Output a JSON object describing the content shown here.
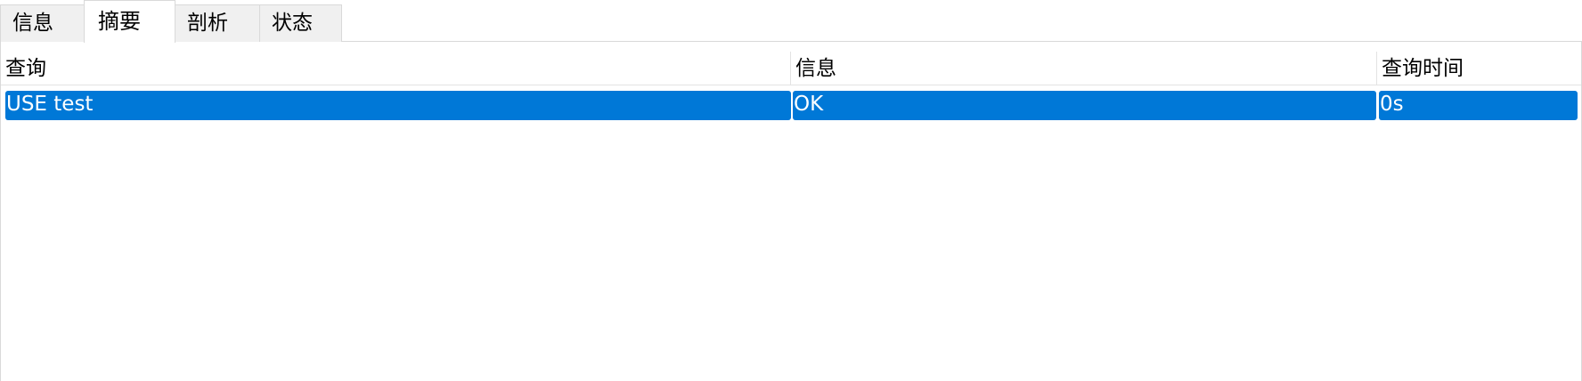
{
  "tabs": [
    {
      "label": "信息",
      "active": false
    },
    {
      "label": "摘要",
      "active": true
    },
    {
      "label": "剖析",
      "active": false
    },
    {
      "label": "状态",
      "active": false
    }
  ],
  "table": {
    "columns": [
      "查询",
      "信息",
      "查询时间"
    ],
    "rows": [
      {
        "query": "USE test",
        "info": "OK",
        "time": "0s",
        "selected": true
      }
    ]
  },
  "colors": {
    "selection": "#0078d7",
    "selection_text": "#ffffff",
    "tab_inactive_bg": "#f0f0f0",
    "border": "#d9d9d9"
  }
}
